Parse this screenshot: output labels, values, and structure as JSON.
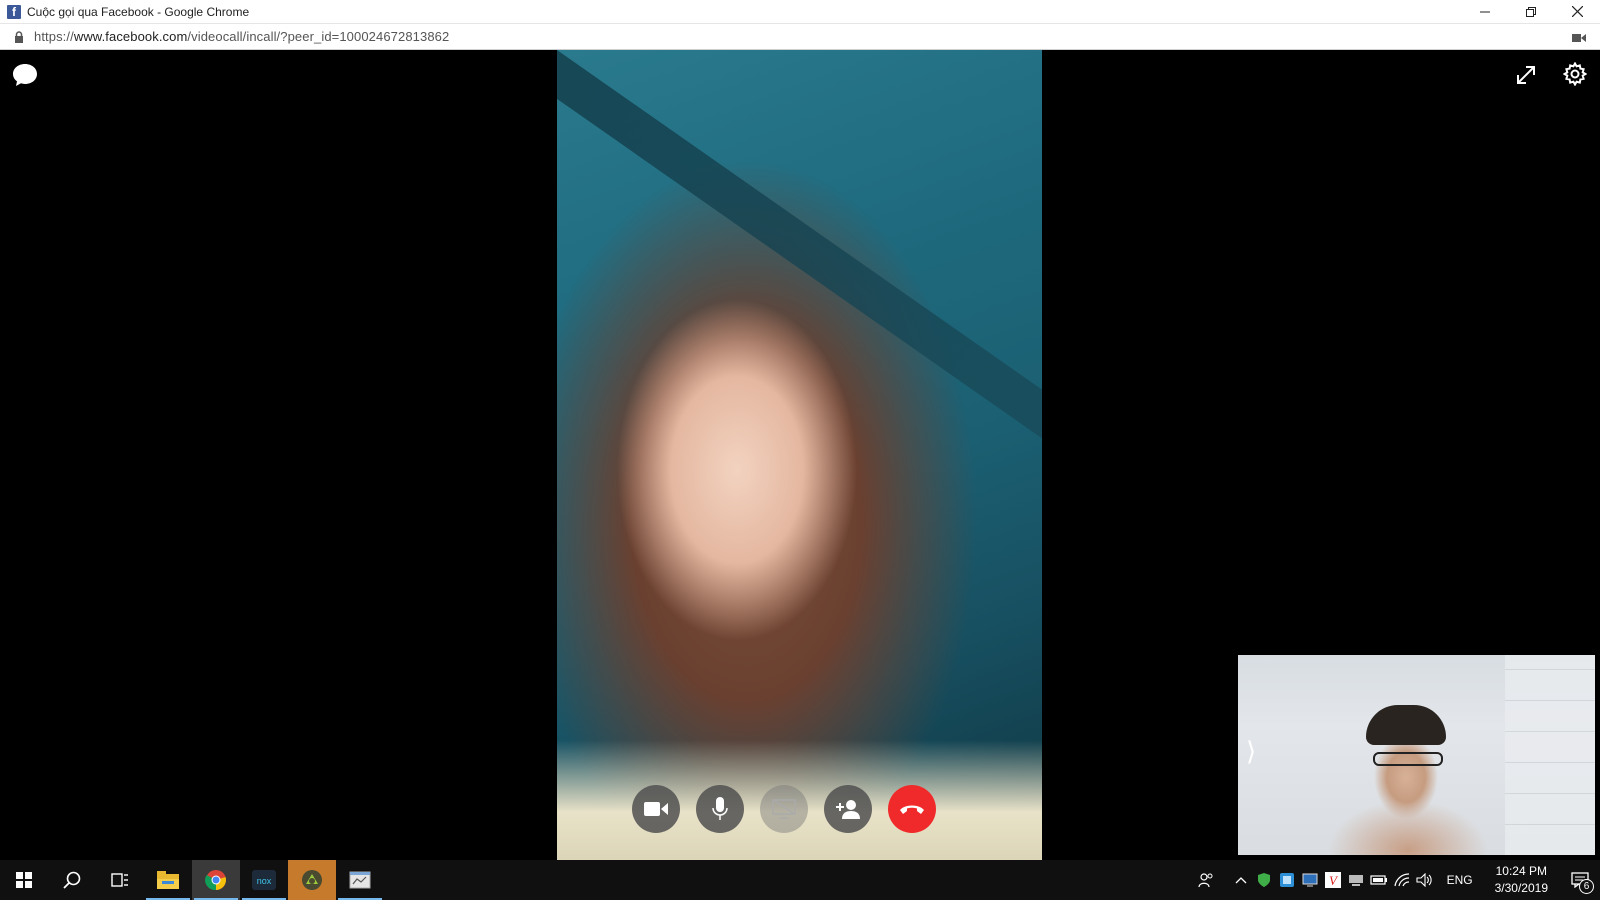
{
  "window": {
    "title": "Cuộc gọi qua Facebook - Google Chrome",
    "favicon_letter": "f",
    "controls": [
      "minimize-icon",
      "restore-icon",
      "close-icon"
    ]
  },
  "address_bar": {
    "scheme": "https://",
    "domain": "www.facebook.com",
    "path": "/videocall/incall/?peer_id=100024672813862"
  },
  "call": {
    "top_left": {
      "icon": "chat-bubble-icon"
    },
    "top_right": [
      "expand-icon",
      "gear-icon"
    ],
    "controls": [
      {
        "name": "camera-button",
        "icon": "video-camera-icon",
        "enabled": true
      },
      {
        "name": "mic-button",
        "icon": "microphone-icon",
        "enabled": true
      },
      {
        "name": "screen-share-button",
        "icon": "screen-share-icon",
        "enabled": false
      },
      {
        "name": "add-person-button",
        "icon": "add-person-icon",
        "enabled": true
      },
      {
        "name": "end-call-button",
        "icon": "phone-hangup-icon",
        "enabled": true
      }
    ],
    "self_view": {
      "arrow": "⟩"
    },
    "end_color": "#f02a2a"
  },
  "taskbar": {
    "apps": [
      "windows-start-icon",
      "search-icon",
      "task-view-icon",
      "file-explorer-icon",
      "chrome-icon",
      "nox-icon",
      "android-icon",
      "app-window-icon"
    ],
    "tray": {
      "language": "ENG",
      "time": "10:24 PM",
      "date": "3/30/2019",
      "notification_count": "6"
    }
  }
}
